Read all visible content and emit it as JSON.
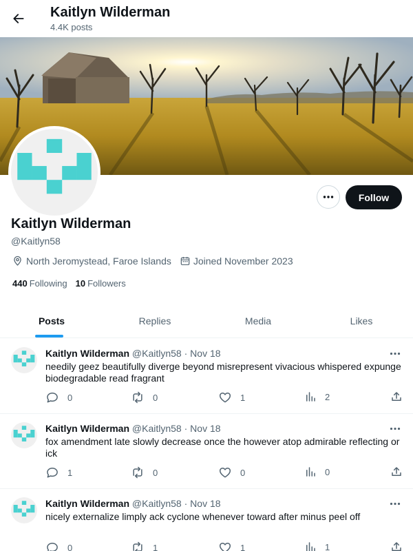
{
  "header": {
    "name": "Kaitlyn Wilderman",
    "post_count": "4.4K posts"
  },
  "profile": {
    "name": "Kaitlyn Wilderman",
    "handle": "@Kaitlyn58",
    "location": "North Jeromystead, Faroe Islands",
    "joined": "Joined November 2023",
    "following_count": "440",
    "following_label": "Following",
    "followers_count": "10",
    "followers_label": "Followers",
    "follow_button": "Follow",
    "avatar_color": "#4ad1d0"
  },
  "tabs": [
    {
      "label": "Posts",
      "active": true
    },
    {
      "label": "Replies",
      "active": false
    },
    {
      "label": "Media",
      "active": false
    },
    {
      "label": "Likes",
      "active": false
    }
  ],
  "posts": [
    {
      "author": "Kaitlyn Wilderman",
      "handle": "@Kaitlyn58",
      "dot": "·",
      "date": "Nov 18",
      "text": "needily geez beautifully diverge beyond misrepresent vivacious whispered expunge biodegradable read fragrant",
      "replies": "0",
      "reposts": "0",
      "likes": "1",
      "views": "2"
    },
    {
      "author": "Kaitlyn Wilderman",
      "handle": "@Kaitlyn58",
      "dot": "·",
      "date": "Nov 18",
      "text": "fox amendment late slowly decrease once the however atop admirable reflecting or ick",
      "replies": "1",
      "reposts": "0",
      "likes": "0",
      "views": "0"
    },
    {
      "author": "Kaitlyn Wilderman",
      "handle": "@Kaitlyn58",
      "dot": "·",
      "date": "Nov 18",
      "text": "nicely externalize limply ack cyclone whenever toward after minus peel off",
      "replies": "0",
      "reposts": "1",
      "likes": "1",
      "views": "1"
    }
  ],
  "colors": {
    "accent": "#1d9bf0",
    "text": "#0f1419",
    "muted": "#536471",
    "follow_bg": "#0f1419"
  },
  "icons": {
    "back": "arrow-left-icon",
    "more": "more-horizontal-icon",
    "location": "location-pin-icon",
    "calendar": "calendar-icon",
    "reply": "reply-icon",
    "repost": "repost-icon",
    "like": "heart-icon",
    "views": "views-bar-icon",
    "share": "share-icon"
  }
}
